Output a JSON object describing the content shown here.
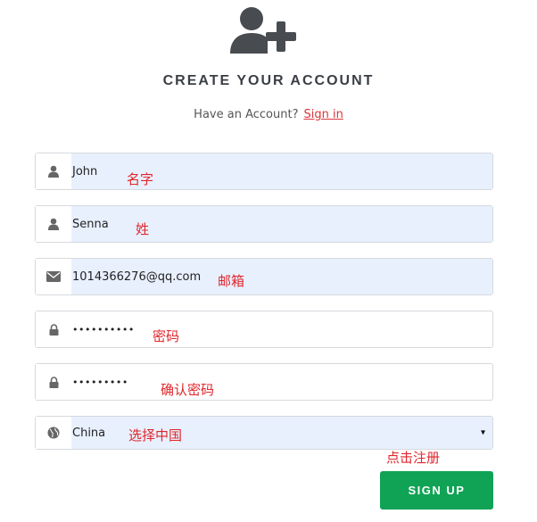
{
  "header": {
    "title": "CREATE YOUR ACCOUNT",
    "subtitle_text": "Have an Account?",
    "signin_link": "Sign in"
  },
  "form": {
    "first_name": {
      "value": "John",
      "annotation": "名字"
    },
    "last_name": {
      "value": "Senna",
      "annotation": "姓"
    },
    "email": {
      "value": "1014366276@qq.com",
      "annotation": "邮箱"
    },
    "password": {
      "value": "••••••••••",
      "annotation": "密码"
    },
    "confirm_password": {
      "value": "•••••••••",
      "annotation": "确认密码"
    },
    "country": {
      "value": "China",
      "annotation": "选择中国",
      "arrow": "▾"
    }
  },
  "signup": {
    "annotation": "点击注册",
    "label": "SIGN UP"
  },
  "colors": {
    "accent": "#d9353a",
    "button": "#10a355",
    "autofill": "#e8f0fe",
    "icon": "#555555"
  },
  "icons": {
    "logo": "add-user-icon",
    "user": "user-icon",
    "email": "envelope-icon",
    "password": "lock-icon",
    "country": "globe-icon"
  }
}
